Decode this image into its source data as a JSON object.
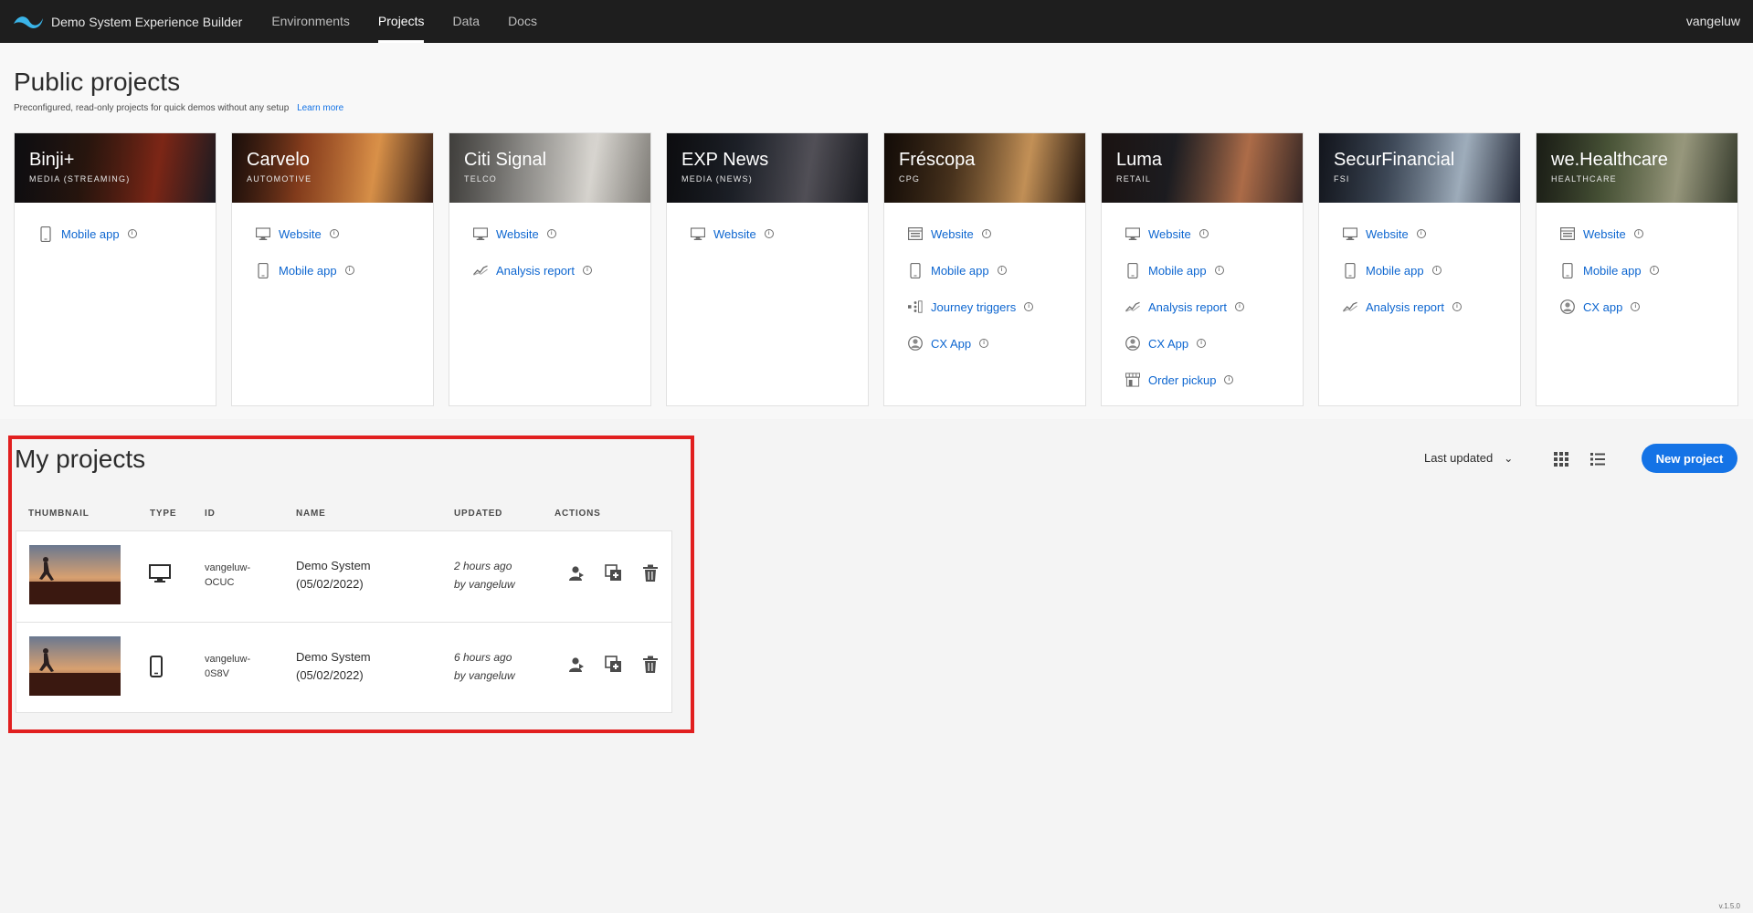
{
  "header": {
    "app_title": "Demo System Experience Builder",
    "tabs": [
      "Environments",
      "Projects",
      "Data",
      "Docs"
    ],
    "active_tab": "Projects",
    "user": "vangeluw"
  },
  "public_projects": {
    "title": "Public projects",
    "subtitle": "Preconfigured, read-only projects for quick demos without any setup",
    "learn_more": "Learn more",
    "cards": [
      {
        "name": "Binji+",
        "category": "MEDIA (STREAMING)",
        "links": [
          {
            "icon": "mobile-icon",
            "label": "Mobile app"
          }
        ]
      },
      {
        "name": "Carvelo",
        "category": "AUTOMOTIVE",
        "links": [
          {
            "icon": "desktop-icon",
            "label": "Website"
          },
          {
            "icon": "mobile-icon",
            "label": "Mobile app"
          }
        ]
      },
      {
        "name": "Citi Signal",
        "category": "TELCO",
        "links": [
          {
            "icon": "desktop-icon",
            "label": "Website"
          },
          {
            "icon": "chart-line-icon",
            "label": "Analysis report"
          }
        ]
      },
      {
        "name": "EXP News",
        "category": "MEDIA (NEWS)",
        "links": [
          {
            "icon": "desktop-icon",
            "label": "Website"
          }
        ]
      },
      {
        "name": "Fréscopa",
        "category": "CPG",
        "links": [
          {
            "icon": "browser-icon",
            "label": "Website"
          },
          {
            "icon": "mobile-icon",
            "label": "Mobile app"
          },
          {
            "icon": "journey-icon",
            "label": "Journey triggers"
          },
          {
            "icon": "user-circle-icon",
            "label": "CX App"
          }
        ]
      },
      {
        "name": "Luma",
        "category": "RETAIL",
        "links": [
          {
            "icon": "desktop-icon",
            "label": "Website"
          },
          {
            "icon": "mobile-icon",
            "label": "Mobile app"
          },
          {
            "icon": "chart-line-icon",
            "label": "Analysis report"
          },
          {
            "icon": "user-circle-icon",
            "label": "CX App"
          },
          {
            "icon": "store-icon",
            "label": "Order pickup"
          }
        ]
      },
      {
        "name": "SecurFinancial",
        "category": "FSI",
        "links": [
          {
            "icon": "desktop-icon",
            "label": "Website"
          },
          {
            "icon": "mobile-icon",
            "label": "Mobile app"
          },
          {
            "icon": "chart-line-icon",
            "label": "Analysis report"
          }
        ]
      },
      {
        "name": "we.Healthcare",
        "category": "HEALTHCARE",
        "links": [
          {
            "icon": "browser-icon",
            "label": "Website"
          },
          {
            "icon": "mobile-icon",
            "label": "Mobile app"
          },
          {
            "icon": "user-circle-icon",
            "label": "CX app"
          }
        ]
      }
    ]
  },
  "my_projects": {
    "title": "My projects",
    "sort_label": "Last updated",
    "new_project": "New project",
    "columns": [
      "THUMBNAIL",
      "TYPE",
      "ID",
      "NAME",
      "UPDATED",
      "ACTIONS"
    ],
    "rows": [
      {
        "type": "desktop-icon",
        "id_line1": "vangeluw-",
        "id_line2": "OCUC",
        "name_line1": "Demo System",
        "name_line2": "(05/02/2022)",
        "updated_line1": "2 hours ago",
        "updated_line2": "by vangeluw"
      },
      {
        "type": "mobile-icon",
        "id_line1": "vangeluw-",
        "id_line2": "0S8V",
        "name_line1": "Demo System",
        "name_line2": "(05/02/2022)",
        "updated_line1": "6 hours ago",
        "updated_line2": "by vangeluw"
      }
    ]
  },
  "version": "v.1.5.0",
  "colors": {
    "accent": "#1473e6",
    "link": "#0d66d0",
    "highlight": "#e11f1f",
    "topbar": "#1e1e1e"
  }
}
